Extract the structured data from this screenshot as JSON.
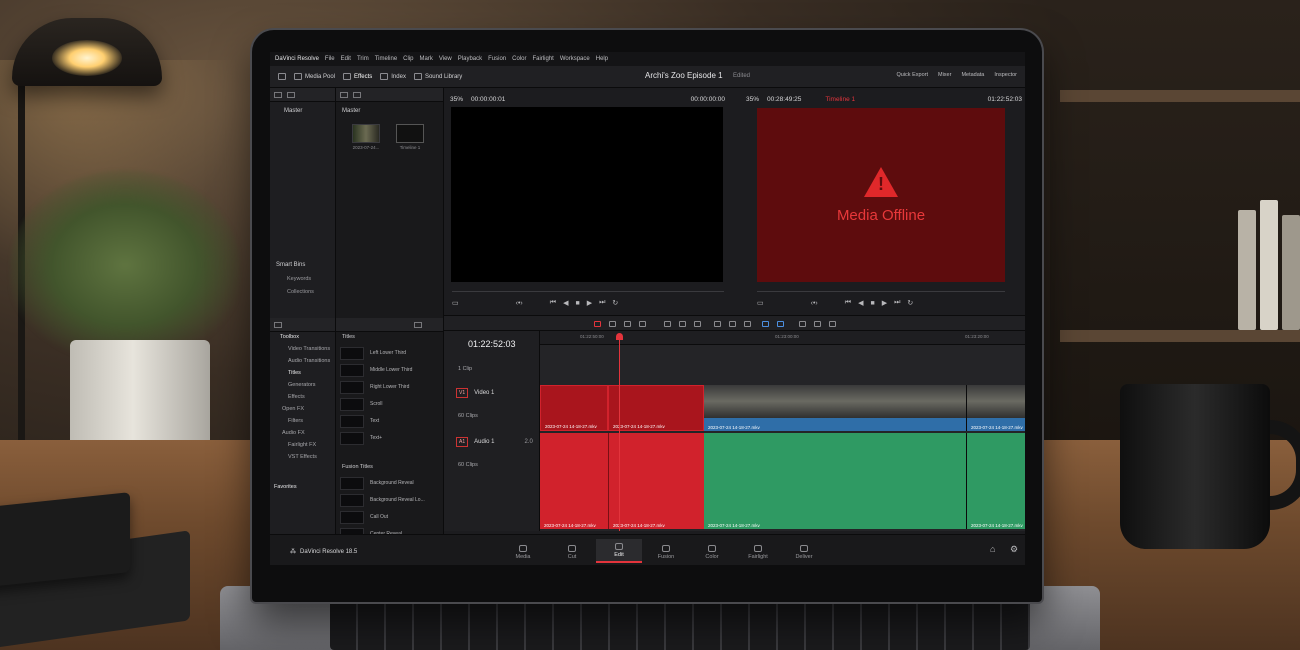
{
  "menu": [
    "DaVinci Resolve",
    "File",
    "Edit",
    "Trim",
    "Timeline",
    "Clip",
    "Mark",
    "View",
    "Playback",
    "Fusion",
    "Color",
    "Fairlight",
    "Workspace",
    "Help"
  ],
  "toolbar": {
    "media_pool": "Media Pool",
    "effects": "Effects",
    "index": "Index",
    "sound_library": "Sound Library",
    "project_title": "Archi's Zoo Episode 1",
    "project_status": "Edited",
    "quick_export": "Quick Export",
    "mixer": "Mixer",
    "metadata": "Metadata",
    "inspector": "Inspector"
  },
  "bins": {
    "master": "Master",
    "smart_bins": "Smart Bins",
    "keywords": "Keywords",
    "collections": "Collections"
  },
  "pool": {
    "header": "Master",
    "clips": [
      {
        "caption": "2023-07-24..."
      },
      {
        "caption": "Timeline 1"
      }
    ]
  },
  "source_viewer": {
    "zoom": "35%",
    "timecode": "00:00:00:01",
    "right_timecode": "00:00:00:00"
  },
  "timeline_viewer": {
    "zoom": "35%",
    "duration": "00:28:49:25",
    "timeline_name": "Timeline 1",
    "timecode": "01:22:52:03",
    "offline_text": "Media Offline"
  },
  "effects_tree": {
    "toolbox": "Toolbox",
    "video_transitions": "Video Transitions",
    "audio_transitions": "Audio Transitions",
    "titles": "Titles",
    "generators": "Generators",
    "effects": "Effects",
    "open_fx": "Open FX",
    "filters": "Filters",
    "audio_fx": "Audio FX",
    "fairlight_fx": "Fairlight FX",
    "vst_effects": "VST Effects",
    "favorites": "Favorites"
  },
  "titles_list": {
    "header": "Titles",
    "items": [
      "Left Lower Third",
      "Middle Lower Third",
      "Right Lower Third",
      "Scroll",
      "Text",
      "Text+"
    ],
    "fusion_header": "Fusion Titles",
    "fusion_items": [
      "Background Reveal",
      "Background Reveal Lo...",
      "Call Out",
      "Center Reveal"
    ]
  },
  "timeline": {
    "timecode": "01:22:52:03",
    "top_track_count": "1 Clip",
    "video_track": {
      "badge": "V1",
      "name": "Video 1",
      "count": "60 Clips"
    },
    "audio_track": {
      "badge": "A1",
      "name": "Audio 1",
      "level": "2.0",
      "count": "60 Clips"
    },
    "ruler": [
      "01:22:50:00",
      "01:23:00:00",
      "01:23:20:00"
    ],
    "clip_names": {
      "v1": "2023-07-24 14-18-27.mkv",
      "v2": "2023-07-24 14-18-27.mkv",
      "v3": "2023-07-24 14-18-27.mkv",
      "v4": "2023-07-24 14-18-27.mkv",
      "a1": "2023-07-24 14-18-27.mkv",
      "a2": "2023-07-24 14-18-27.mkv",
      "a3": "2023-07-24 14-18-27.mkv",
      "a4": "2023-07-24 14-18-27.mkv"
    }
  },
  "pages": [
    "Media",
    "Cut",
    "Edit",
    "Fusion",
    "Color",
    "Fairlight",
    "Deliver"
  ],
  "brand": "DaVinci Resolve 18.5",
  "colors": {
    "accent": "#e3343c",
    "offline_bg": "#5e0c0d",
    "audio_clip": "#2f9a63",
    "video_clip": "#2f6ea8",
    "offline_clip": "#d1222c"
  }
}
